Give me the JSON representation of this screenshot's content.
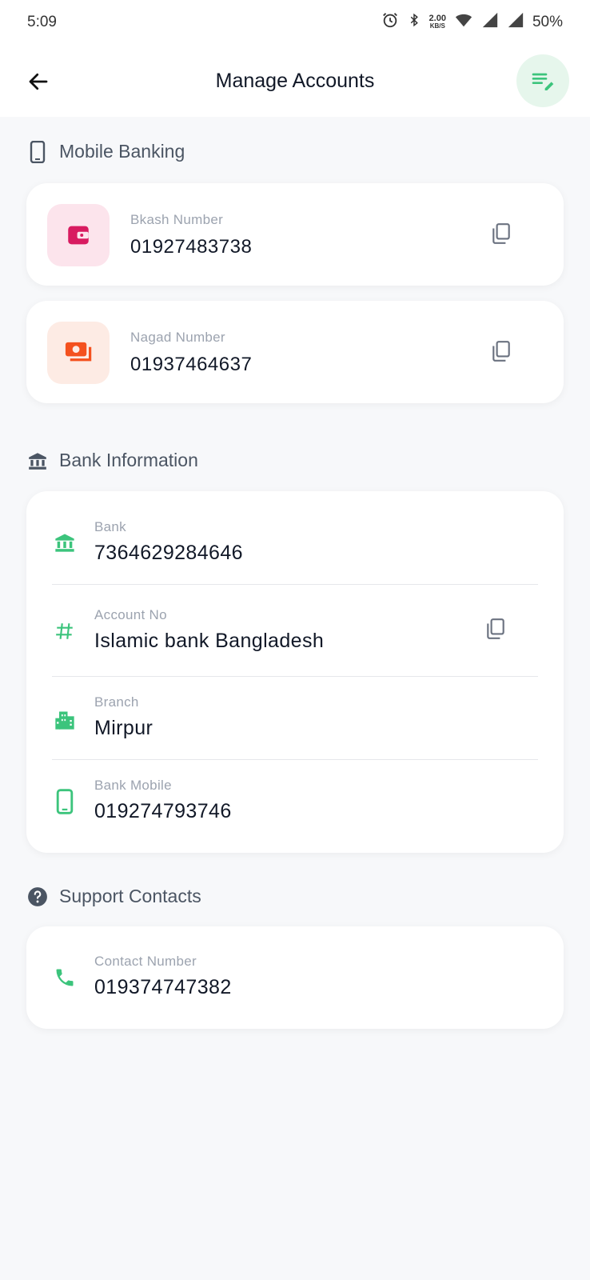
{
  "status_bar": {
    "time": "5:09",
    "network_speed_value": "2.00",
    "network_speed_unit": "KB/S",
    "battery": "50%"
  },
  "app_bar": {
    "title": "Manage Accounts"
  },
  "mobile_banking": {
    "heading": "Mobile Banking",
    "accounts": [
      {
        "label": "Bkash Number",
        "value": "01927483738",
        "icon": "wallet-icon",
        "color": "#d81b60",
        "bg": "#fce4ec"
      },
      {
        "label": "Nagad Number",
        "value": "01937464637",
        "icon": "payments-icon",
        "color": "#f4511e",
        "bg": "#fdebe4"
      }
    ]
  },
  "bank_information": {
    "heading": "Bank Information",
    "rows": [
      {
        "label": "Bank",
        "value": "7364629284646",
        "icon": "bank-icon"
      },
      {
        "label": "Account No",
        "value": "Islamic bank Bangladesh",
        "icon": "hash-icon"
      },
      {
        "label": "Branch",
        "value": "Mirpur",
        "icon": "building-icon"
      },
      {
        "label": "Bank Mobile",
        "value": "019274793746",
        "icon": "phone-icon"
      }
    ]
  },
  "support_contacts": {
    "heading": "Support Contacts",
    "rows": [
      {
        "label": "Contact Number",
        "value": "019374747382",
        "icon": "call-icon"
      }
    ]
  },
  "colors": {
    "accent_green": "#3cc47c",
    "edit_bg": "#e6f6ec",
    "text_primary": "#111827",
    "text_secondary": "#9ca3af",
    "background": "#f7f8fa"
  }
}
